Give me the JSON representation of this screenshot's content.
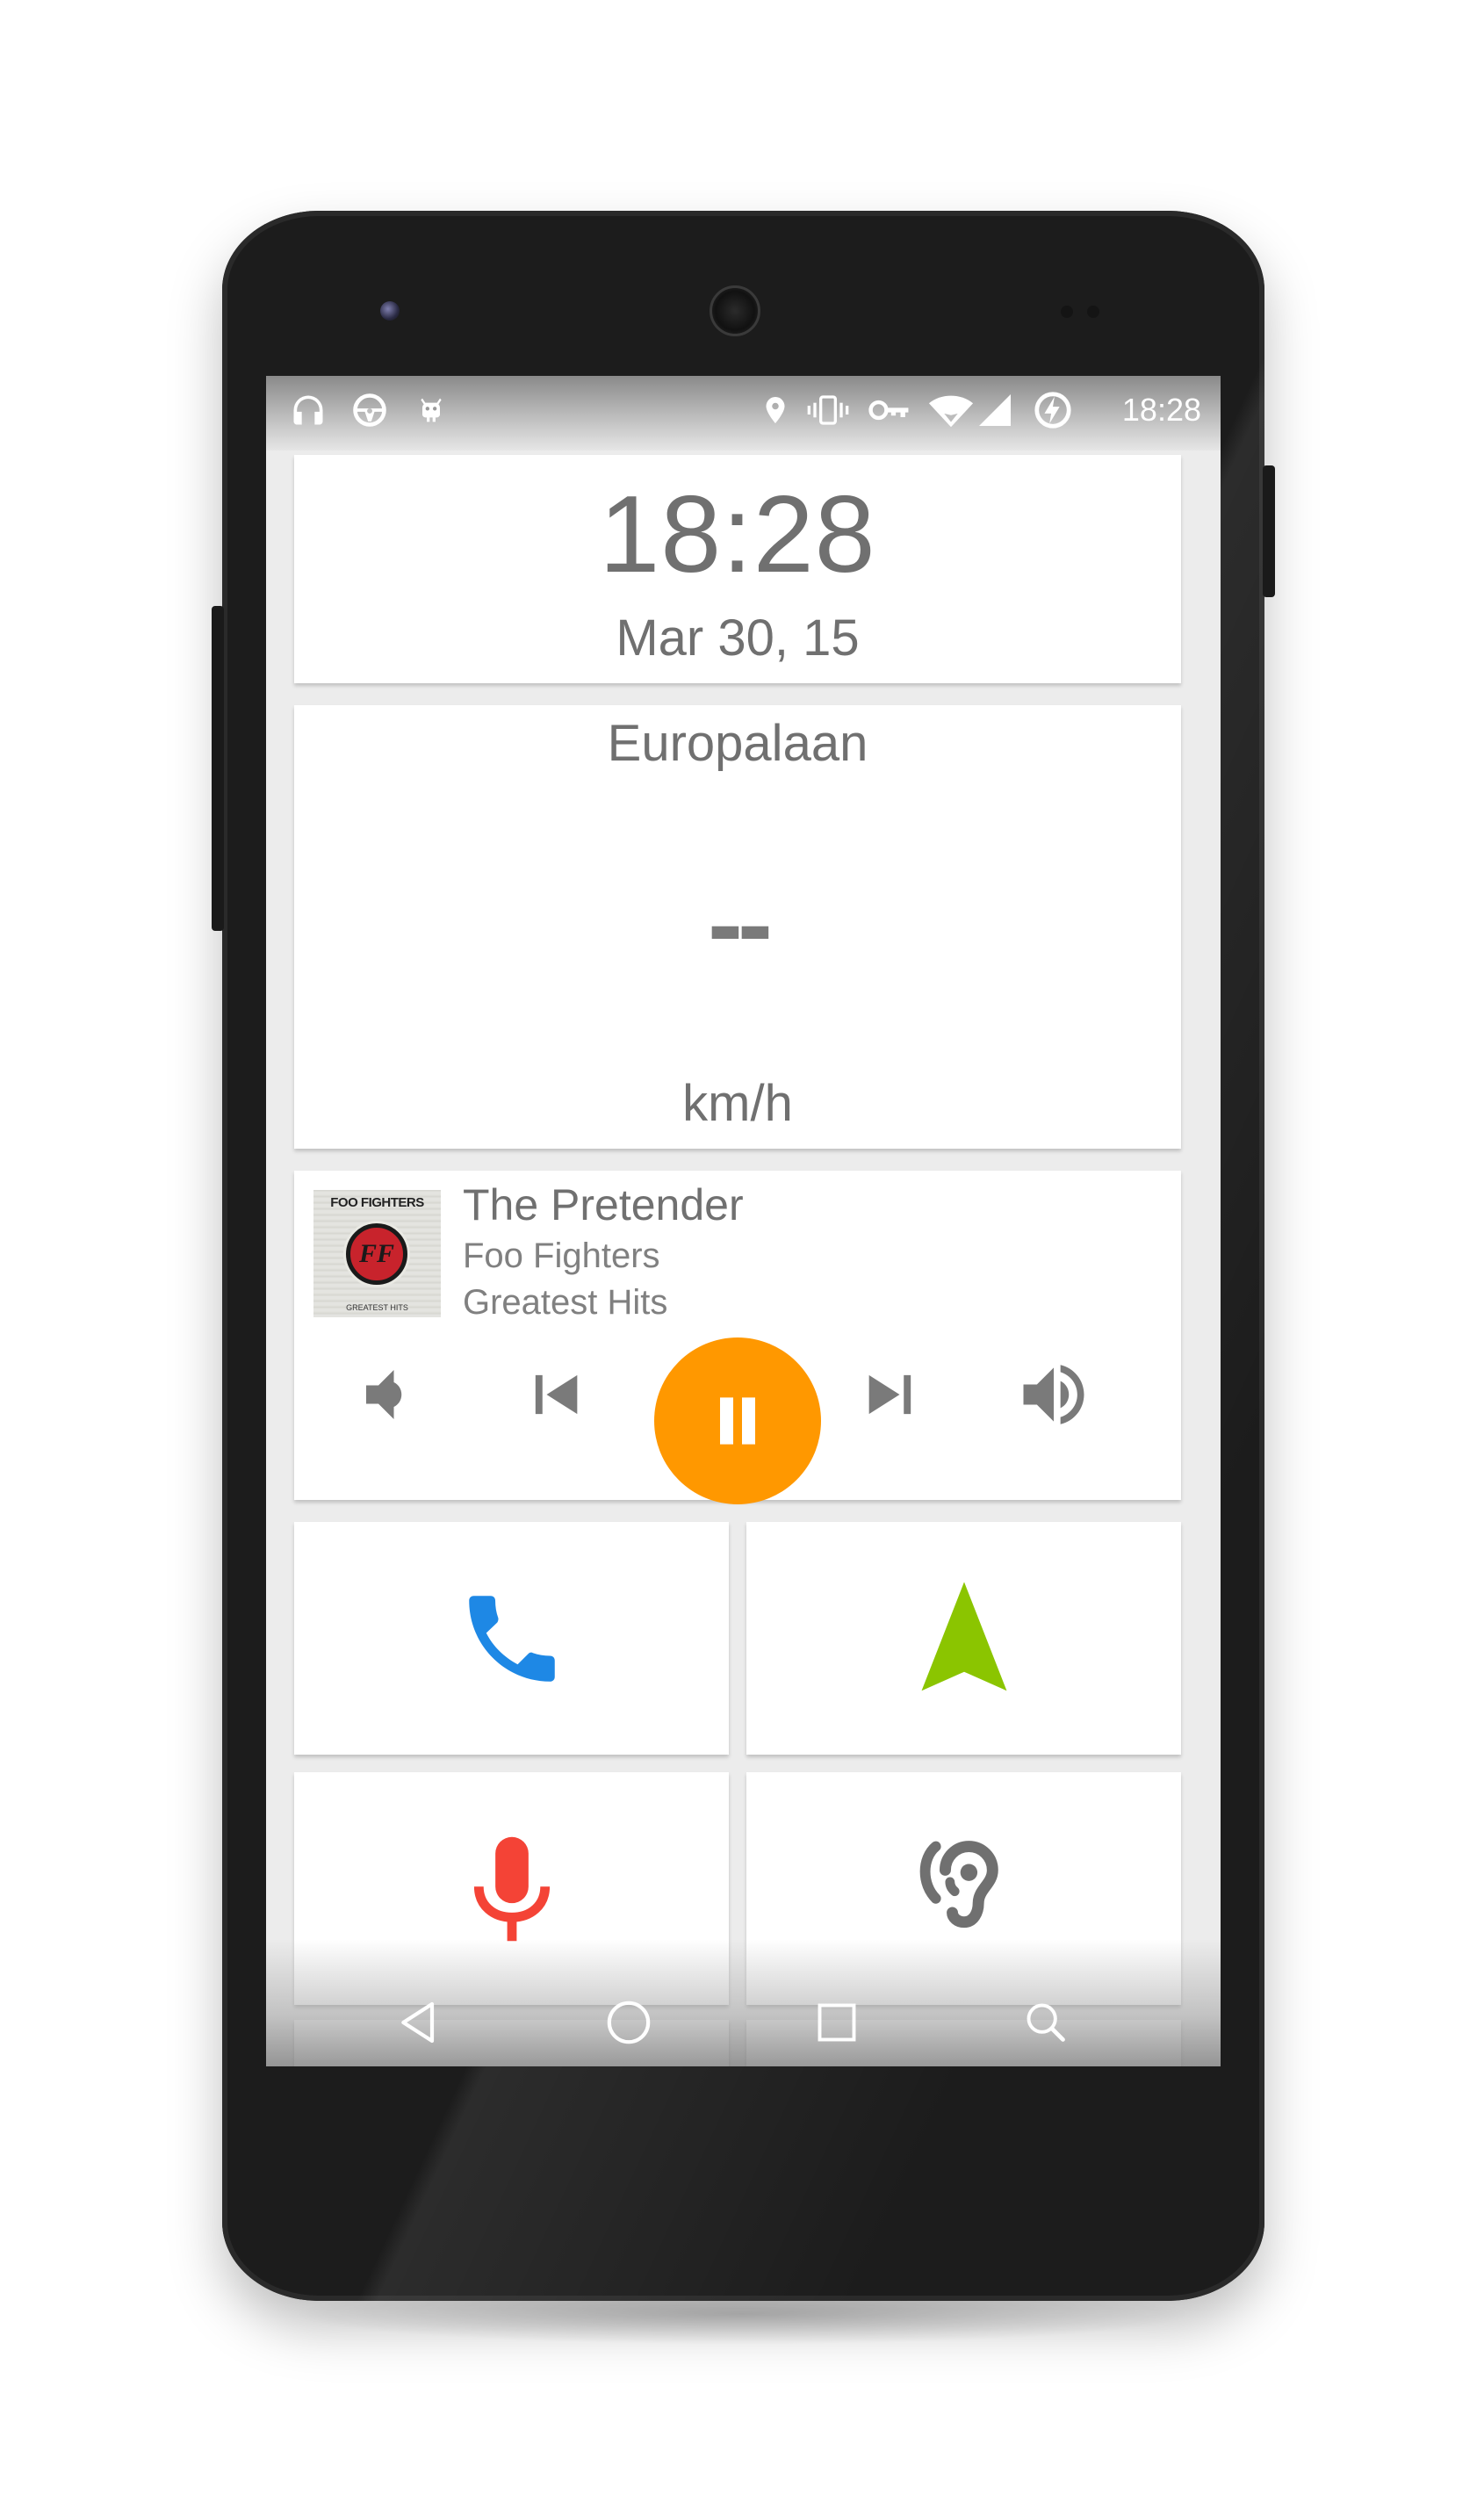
{
  "status_bar": {
    "time": "18:28",
    "left_icons": [
      "headphones-icon",
      "steering-wheel-icon",
      "cyanogen-bugdroid-icon"
    ],
    "right_icons": [
      "location-pin-icon",
      "vibrate-icon",
      "vpn-key-icon",
      "wifi-icon",
      "cell-signal-icon",
      "battery-charging-icon"
    ]
  },
  "clock_card": {
    "time": "18:28",
    "date": "Mar 30, 15"
  },
  "speed_card": {
    "street": "Europalaan",
    "speed": "--",
    "unit": "km/h"
  },
  "media_card": {
    "title": "The Pretender",
    "artist": "Foo Fighters",
    "album": "Greatest Hits",
    "album_art": {
      "band_text": "FOO FIGHTERS",
      "logo_text": "FF",
      "subtitle_text": "GREATEST HITS"
    },
    "state": "playing",
    "controls": [
      "volume-down-icon",
      "skip-previous-icon",
      "pause-icon",
      "skip-next-icon",
      "volume-up-icon"
    ],
    "play_button_color": "#ff9800"
  },
  "tiles": [
    {
      "name": "phone",
      "icon": "phone-icon",
      "color": "#1e88e5"
    },
    {
      "name": "navigation",
      "icon": "navigation-arrow-icon",
      "color": "#8bc500"
    },
    {
      "name": "voice",
      "icon": "microphone-icon",
      "color": "#f44336"
    },
    {
      "name": "ear",
      "icon": "hearing-icon",
      "color": "#707070"
    }
  ],
  "nav_bar": {
    "buttons": [
      "back-icon",
      "home-icon",
      "recents-icon",
      "search-icon"
    ]
  },
  "colors": {
    "text_gray": "#707070",
    "card_bg": "#ffffff",
    "screen_bg": "#ececec",
    "accent_orange": "#ff9800",
    "phone_blue": "#1e88e5",
    "nav_green": "#8bc500",
    "mic_red": "#f44336"
  }
}
